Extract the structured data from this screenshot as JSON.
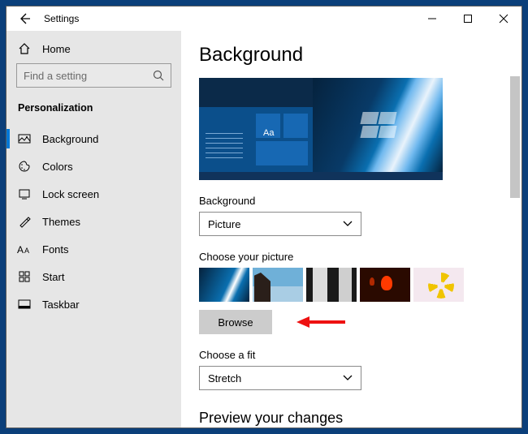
{
  "window": {
    "title": "Settings"
  },
  "sidebar": {
    "home": "Home",
    "search_placeholder": "Find a setting",
    "section": "Personalization",
    "items": [
      {
        "label": "Background",
        "active": true
      },
      {
        "label": "Colors"
      },
      {
        "label": "Lock screen"
      },
      {
        "label": "Themes"
      },
      {
        "label": "Fonts"
      },
      {
        "label": "Start"
      },
      {
        "label": "Taskbar"
      }
    ]
  },
  "main": {
    "heading": "Background",
    "preview_aa": "Aa",
    "bg_label": "Background",
    "bg_value": "Picture",
    "choose_label": "Choose your picture",
    "browse": "Browse",
    "fit_label": "Choose a fit",
    "fit_value": "Stretch",
    "preview_heading": "Preview your changes"
  }
}
